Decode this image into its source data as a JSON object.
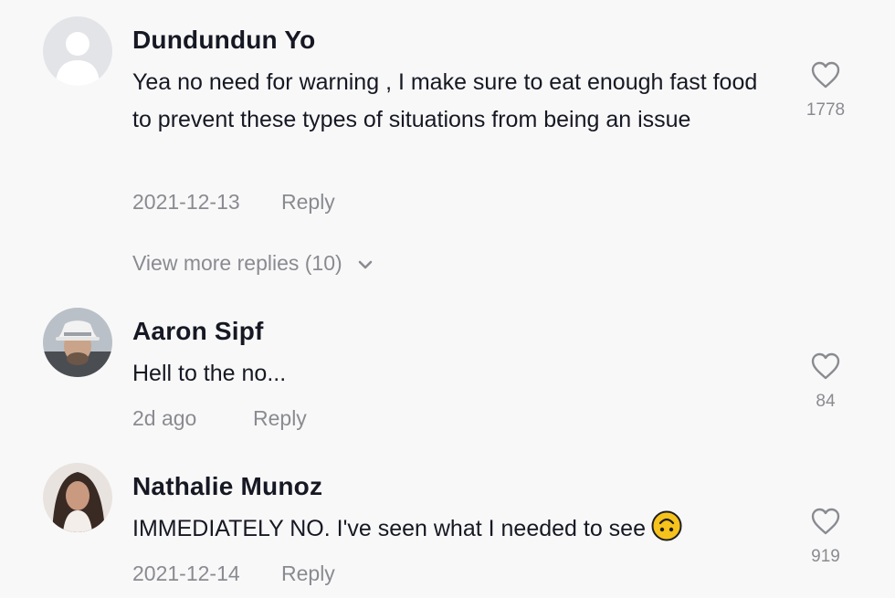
{
  "comments": [
    {
      "author": "Dundundun Yo",
      "text": "Yea no need for warning , I make sure to eat enough fast food to prevent these types of situations from being an issue",
      "date": "2021-12-13",
      "reply_label": "Reply",
      "likes": "1778",
      "view_more": "View more replies (10)"
    },
    {
      "author": "Aaron Sipf",
      "text": "Hell to the no...",
      "date": "2d ago",
      "reply_label": "Reply",
      "likes": "84"
    },
    {
      "author": "Nathalie Munoz",
      "text": "IMMEDIATELY NO. I've seen what I needed to see",
      "date": "2021-12-14",
      "reply_label": "Reply",
      "likes": "919"
    }
  ],
  "icons": {
    "heart": "heart-outline-icon",
    "chevron": "chevron-down-icon",
    "emoji": "upside-down-face-emoji"
  },
  "colors": {
    "background": "#f8f8f8",
    "text_primary": "#161823",
    "text_secondary": "#8a8b91",
    "emoji": "#f6c21c"
  }
}
